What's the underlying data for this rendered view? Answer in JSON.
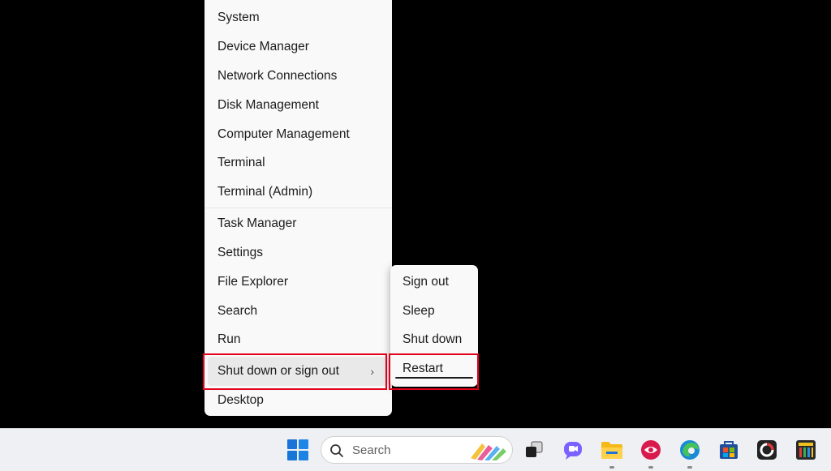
{
  "context_menu": {
    "groups": [
      [
        "System",
        "Device Manager",
        "Network Connections",
        "Disk Management",
        "Computer Management",
        "Terminal",
        "Terminal (Admin)"
      ],
      [
        "Task Manager",
        "Settings",
        "File Explorer",
        "Search",
        "Run",
        "Shut down or sign out",
        "Desktop"
      ]
    ],
    "highlighted_item": "Shut down or sign out",
    "submenu_chevron": "›"
  },
  "power_submenu": {
    "items": [
      "Sign out",
      "Sleep",
      "Shut down",
      "Restart"
    ],
    "highlighted_item": "Restart"
  },
  "annotation": {
    "highlight_color": "#e3001b"
  },
  "taskbar": {
    "search_placeholder": "Search",
    "icons": [
      "start-icon",
      "search-icon",
      "task-view-icon",
      "teams-chat-icon",
      "file-explorer-icon",
      "app-icon",
      "edge-icon",
      "store-icon",
      "app-icon",
      "app-icon"
    ]
  },
  "colors": {
    "menu_background": "#f9f9f9",
    "taskbar_background": "#eef0f3",
    "highlight_row": "#e9e9e9"
  }
}
